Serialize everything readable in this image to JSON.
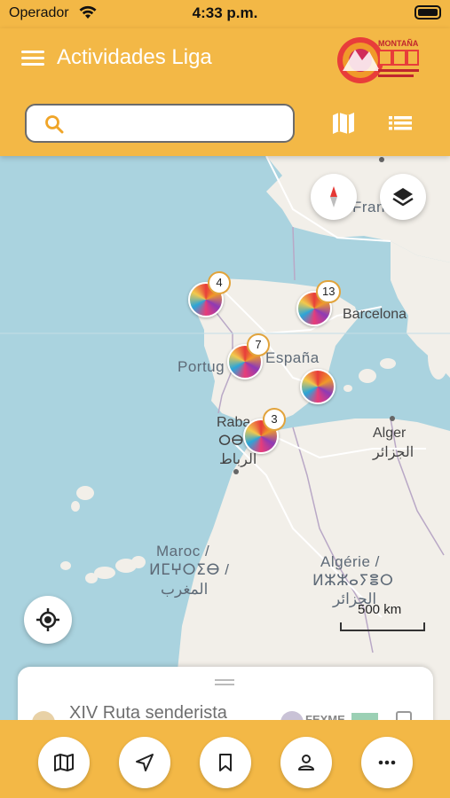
{
  "status_bar": {
    "carrier": "Operador",
    "time": "4:33 p.m."
  },
  "app_bar": {
    "title": "Actividades Liga",
    "logo_text": "MONTAÑA",
    "search": {
      "value": "",
      "placeholder": ""
    }
  },
  "map": {
    "labels": {
      "france": "Francia",
      "barcelona": "Barcelona",
      "portugal": "Portug",
      "espana": "España",
      "rabat": "Raba",
      "rabat_tifinagh": "ⵔⴱⴰ",
      "rabat_ar": "الرباط",
      "alger": "Alger",
      "alger_ar": "الجزائر",
      "maroc": "Maroc /",
      "maroc_tifinagh": "ⵍⵎⵖⵔⵉⴱ /",
      "maroc_ar": "المغرب",
      "algerie": "Algérie /",
      "algerie_tifinagh": "ⵍⵣⵣⴰⵢⴻⵔ",
      "algerie_ar": "الجزائر"
    },
    "clusters": [
      {
        "count": "4"
      },
      {
        "count": "13"
      },
      {
        "count": "7"
      },
      {
        "count": ""
      },
      {
        "count": "3"
      }
    ],
    "scale_label": "500 km"
  },
  "bottom_sheet": {
    "item_title": "XIV Ruta senderista",
    "org": "FEXME"
  },
  "bottom_nav": {
    "items": [
      "map-icon",
      "navigation-icon",
      "bookmark-icon",
      "profile-icon",
      "more-icon"
    ]
  },
  "colors": {
    "accent": "#f3b846",
    "sea": "#aad3df",
    "land": "#f2efe9"
  }
}
